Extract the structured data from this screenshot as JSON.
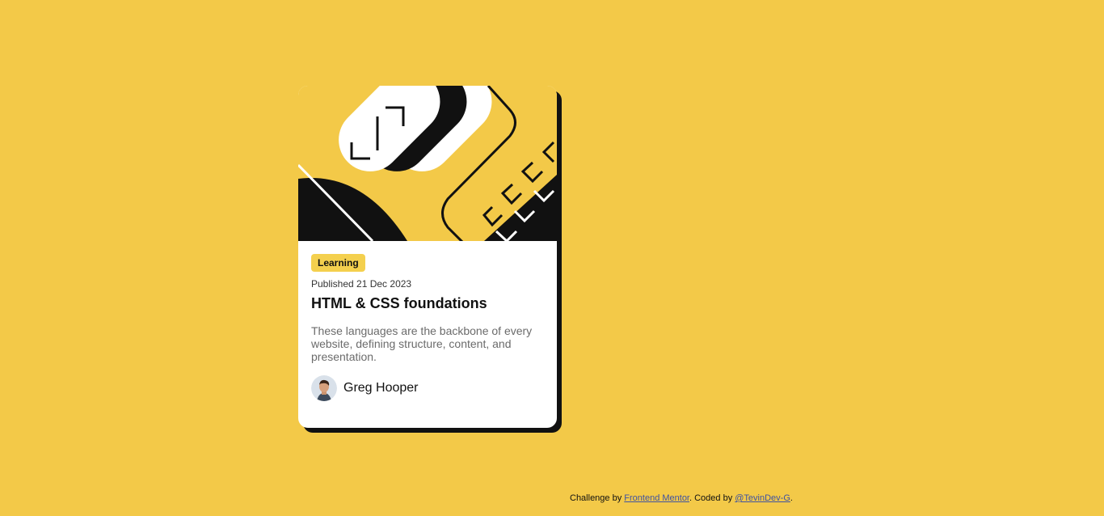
{
  "card": {
    "tag": "Learning",
    "published": "Published 21 Dec 2023",
    "title": "HTML & CSS foundations",
    "description": "These languages are the backbone of every website, defining structure, content, and presentation.",
    "author": {
      "name": "Greg Hooper",
      "avatar_icon": "person-avatar"
    },
    "hero_icon": "abstract-illustration"
  },
  "attribution": {
    "prefix": "Challenge by ",
    "link1": "Frontend Mentor",
    "middle": ". Coded by ",
    "link2": "@TevinDev-G",
    "suffix": "."
  },
  "colors": {
    "background": "#f3c948",
    "accent": "#f4d04e",
    "card": "#ffffff",
    "shadow": "#111111",
    "link": "#3e52a3"
  }
}
